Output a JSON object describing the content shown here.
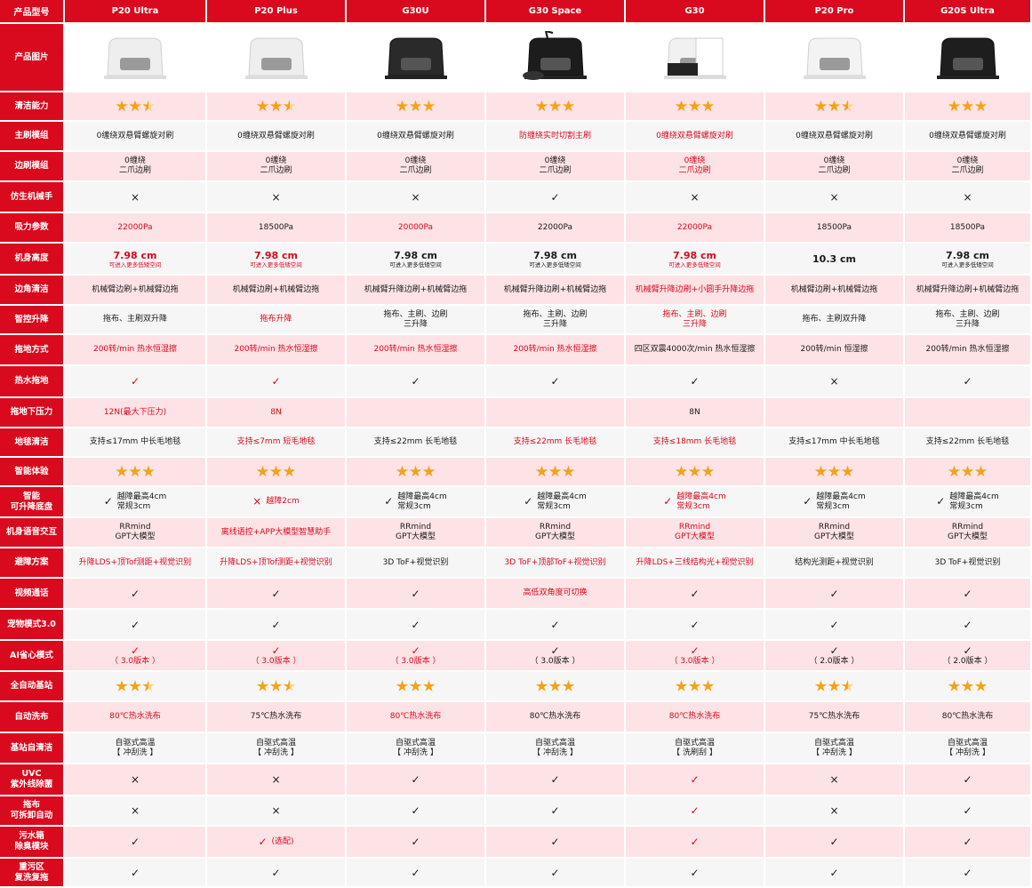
{
  "header_label": "产品型号",
  "models": [
    "P20 Ultra",
    "P20 Plus",
    "G30U",
    "G30 Space",
    "G30",
    "P20 Pro",
    "G20S Ultra"
  ],
  "image_row_label": "产品图片",
  "product_images": [
    {
      "icon": "robot-base-white-icon",
      "color": "#eeeeee"
    },
    {
      "icon": "robot-base-white-icon",
      "color": "#eeeeee"
    },
    {
      "icon": "robot-base-black-icon",
      "color": "#2a2a2a"
    },
    {
      "icon": "robot-base-black-arm-icon",
      "color": "#1c1c1c"
    },
    {
      "icon": "robot-base-white-black-icon",
      "color": "#f1f1f1"
    },
    {
      "icon": "robot-base-white-icon",
      "color": "#f3f3f3"
    },
    {
      "icon": "robot-base-black-icon",
      "color": "#1e1e1e"
    }
  ],
  "accent_color": "#d9091e",
  "star_color": "#f3a21a",
  "rows": [
    {
      "label": "清洁能力",
      "cells": [
        {
          "stars": 2.5
        },
        {
          "stars": 2.5
        },
        {
          "stars": 3
        },
        {
          "stars": 3
        },
        {
          "stars": 3
        },
        {
          "stars": 2.5
        },
        {
          "stars": 3
        }
      ]
    },
    {
      "label": "主刷模组",
      "cells": [
        {
          "text": "0缠绕双悬臂螺旋对刷"
        },
        {
          "text": "0缠绕双悬臂螺旋对刷"
        },
        {
          "text": "0缠绕双悬臂螺旋对刷"
        },
        {
          "text": "防缠绕实时切割主刷",
          "red": true
        },
        {
          "text": "0缠绕双悬臂螺旋对刷",
          "red": true
        },
        {
          "text": "0缠绕双悬臂螺旋对刷"
        },
        {
          "text": "0缠绕双悬臂螺旋对刷"
        }
      ]
    },
    {
      "label": "边刷模组",
      "cells": [
        {
          "text": "0缠绕\n二爪边刷"
        },
        {
          "text": "0缠绕\n二爪边刷"
        },
        {
          "text": "0缠绕\n二爪边刷"
        },
        {
          "text": "0缠绕\n二爪边刷"
        },
        {
          "text": "0缠绕\n二爪边刷",
          "red": true
        },
        {
          "text": "0缠绕\n二爪边刷"
        },
        {
          "text": "0缠绕\n二爪边刷"
        }
      ]
    },
    {
      "label": "仿生机械手",
      "cells": [
        {
          "mark": "×"
        },
        {
          "mark": "×"
        },
        {
          "mark": "×"
        },
        {
          "mark": "✓"
        },
        {
          "mark": "×"
        },
        {
          "mark": "×"
        },
        {
          "mark": "×"
        }
      ]
    },
    {
      "label": "吸力参数",
      "cells": [
        {
          "text": "22000Pa",
          "red": true
        },
        {
          "text": "18500Pa"
        },
        {
          "text": "20000Pa",
          "red": true
        },
        {
          "text": "22000Pa"
        },
        {
          "text": "22000Pa",
          "red": true
        },
        {
          "text": "18500Pa"
        },
        {
          "text": "18500Pa"
        }
      ]
    },
    {
      "label": "机身高度",
      "cells": [
        {
          "big": "7.98 cm",
          "small": "可进入更多低矮空间",
          "red": true
        },
        {
          "big": "7.98 cm",
          "small": "可进入更多低矮空间",
          "red": true
        },
        {
          "big": "7.98 cm",
          "small": "可进入更多低矮空间"
        },
        {
          "big": "7.98 cm",
          "small": "可进入更多低矮空间"
        },
        {
          "big": "7.98 cm",
          "small": "可进入更多低矮空间",
          "red": true
        },
        {
          "big": "10.3 cm"
        },
        {
          "big": "7.98 cm",
          "small": "可进入更多低矮空间"
        }
      ]
    },
    {
      "label": "边角清洁",
      "cells": [
        {
          "text": "机械臂边刷+机械臂边拖"
        },
        {
          "text": "机械臂边刷+机械臂边拖"
        },
        {
          "text": "机械臂升降边刷+机械臂边拖"
        },
        {
          "text": "机械臂升降边刷+机械臂边拖"
        },
        {
          "text": "机械臂升降边刷+小圆手升降边拖",
          "red": true
        },
        {
          "text": "机械臂边刷+机械臂边拖"
        },
        {
          "text": "机械臂升降边刷+机械臂边拖"
        }
      ]
    },
    {
      "label": "智控升降",
      "cells": [
        {
          "text": "拖布、主刷双升降"
        },
        {
          "text": "拖布升降",
          "red": true
        },
        {
          "text": "拖布、主刷、边刷\n三升降"
        },
        {
          "text": "拖布、主刷、边刷\n三升降"
        },
        {
          "text": "拖布、主刷、边刷\n三升降",
          "red": true
        },
        {
          "text": "拖布、主刷双升降"
        },
        {
          "text": "拖布、主刷、边刷\n三升降"
        }
      ]
    },
    {
      "label": "拖地方式",
      "cells": [
        {
          "text": "200转/min 热水恒湿擦",
          "red": true
        },
        {
          "text": "200转/min 热水恒湿擦",
          "red": true
        },
        {
          "text": "200转/min 热水恒湿擦",
          "red": true
        },
        {
          "text": "200转/min 热水恒湿擦",
          "red": true
        },
        {
          "text": "四区双震4000次/min 热水恒湿擦"
        },
        {
          "text": "200转/min 恒湿擦"
        },
        {
          "text": "200转/min 热水恒湿擦"
        }
      ]
    },
    {
      "label": "热水拖地",
      "cells": [
        {
          "mark": "✓",
          "red": true
        },
        {
          "mark": "✓",
          "red": true
        },
        {
          "mark": "✓"
        },
        {
          "mark": "✓"
        },
        {
          "mark": "✓"
        },
        {
          "mark": "×"
        },
        {
          "mark": "✓"
        }
      ]
    },
    {
      "label": "拖地下压力",
      "cells": [
        {
          "text": "12N(最大下压力)",
          "red": true
        },
        {
          "text": "8N",
          "red": true
        },
        {
          "text": ""
        },
        {
          "text": ""
        },
        {
          "text": "8N"
        },
        {
          "text": ""
        },
        {
          "text": ""
        }
      ]
    },
    {
      "label": "地毯清洁",
      "cells": [
        {
          "text": "支持≤17mm 中长毛地毯"
        },
        {
          "text": "支持≤7mm 短毛地毯",
          "red": true
        },
        {
          "text": "支持≤22mm 长毛地毯"
        },
        {
          "text": "支持≤22mm 长毛地毯",
          "red": true
        },
        {
          "text": "支持≤18mm 长毛地毯",
          "red": true
        },
        {
          "text": "支持≤17mm 中长毛地毯"
        },
        {
          "text": "支持≤22mm 长毛地毯"
        }
      ]
    },
    {
      "label": "智能体验",
      "cells": [
        {
          "stars": 3
        },
        {
          "stars": 3
        },
        {
          "stars": 3
        },
        {
          "stars": 3
        },
        {
          "stars": 3
        },
        {
          "stars": 3
        },
        {
          "stars": 3
        }
      ]
    },
    {
      "label": "智能\n可升降底盘",
      "cells": [
        {
          "prefix": "✓",
          "text": "越障最高4cm\n常规3cm"
        },
        {
          "prefix": "×",
          "text": "越障2cm",
          "red": true
        },
        {
          "prefix": "✓",
          "text": "越障最高4cm\n常规3cm"
        },
        {
          "prefix": "✓",
          "text": "越障最高4cm\n常规3cm"
        },
        {
          "prefix": "✓",
          "text": "越障最高4cm\n常规3cm",
          "red": true
        },
        {
          "prefix": "✓",
          "text": "越障最高4cm\n常规3cm"
        },
        {
          "prefix": "✓",
          "text": "越障最高4cm\n常规3cm"
        }
      ]
    },
    {
      "label": "机身语音交互",
      "cells": [
        {
          "text": "RRmind\nGPT大模型"
        },
        {
          "text": "离线语控+APP大模型智慧助手",
          "red": true
        },
        {
          "text": "RRmind\nGPT大模型"
        },
        {
          "text": "RRmind\nGPT大模型"
        },
        {
          "text": "RRmind\nGPT大模型",
          "red": true
        },
        {
          "text": "RRmind\nGPT大模型"
        },
        {
          "text": "RRmind\nGPT大模型"
        }
      ]
    },
    {
      "label": "避障方案",
      "cells": [
        {
          "text": "升降LDS+顶Tof测距+视觉识别",
          "red": true
        },
        {
          "text": "升降LDS+顶Tof测距+视觉识别",
          "red": true
        },
        {
          "text": "3D ToF+视觉识别"
        },
        {
          "text": "3D ToF+顶部ToF+视觉识别",
          "red": true
        },
        {
          "text": "升降LDS+三线结构光+视觉识别",
          "red": true
        },
        {
          "text": "结构光测距+视觉识别"
        },
        {
          "text": "3D ToF+视觉识别"
        }
      ]
    },
    {
      "label": "视频通话",
      "cells": [
        {
          "mark": "✓"
        },
        {
          "mark": "✓"
        },
        {
          "mark": "✓"
        },
        {
          "text": "高低双角度可切换",
          "red": true
        },
        {
          "mark": "✓"
        },
        {
          "mark": "✓"
        },
        {
          "mark": "✓"
        }
      ]
    },
    {
      "label": "宠物模式3.0",
      "cells": [
        {
          "mark": "✓"
        },
        {
          "mark": "✓"
        },
        {
          "mark": "✓"
        },
        {
          "mark": "✓"
        },
        {
          "mark": "✓"
        },
        {
          "mark": "✓"
        },
        {
          "mark": "✓"
        }
      ]
    },
    {
      "label": "AI省心模式",
      "cells": [
        {
          "mark": "✓",
          "text": "（ 3.0版本 ）",
          "red": true
        },
        {
          "mark": "✓",
          "text": "（ 3.0版本 ）",
          "red": true
        },
        {
          "mark": "✓",
          "text": "（ 3.0版本 ）",
          "red": true
        },
        {
          "mark": "✓",
          "text": "（ 3.0版本 ）"
        },
        {
          "mark": "✓",
          "text": "（ 3.0版本 ）",
          "red": true
        },
        {
          "mark": "✓",
          "text": "（ 2.0版本 ）"
        },
        {
          "mark": "✓",
          "text": "（ 2.0版本 ）"
        }
      ]
    },
    {
      "label": "全自动基站",
      "cells": [
        {
          "stars": 2.5
        },
        {
          "stars": 2.5
        },
        {
          "stars": 3
        },
        {
          "stars": 3
        },
        {
          "stars": 3
        },
        {
          "stars": 2.5
        },
        {
          "stars": 3
        }
      ]
    },
    {
      "label": "自动洗布",
      "cells": [
        {
          "text": "80℃热水洗布",
          "red": true
        },
        {
          "text": "75℃热水洗布"
        },
        {
          "text": "80℃热水洗布",
          "red": true
        },
        {
          "text": "80℃热水洗布"
        },
        {
          "text": "80℃热水洗布",
          "red": true
        },
        {
          "text": "75℃热水洗布"
        },
        {
          "text": "80℃热水洗布"
        }
      ]
    },
    {
      "label": "基站自清洁",
      "cells": [
        {
          "text": "自驱式高温\n【 冲刮洗 】"
        },
        {
          "text": "自驱式高温\n【 冲刮洗 】"
        },
        {
          "text": "自驱式高温\n【 冲刮洗 】"
        },
        {
          "text": "自驱式高温\n【 冲刮洗 】"
        },
        {
          "text": "自驱式高温\n【 洗刷刮 】"
        },
        {
          "text": "自驱式高温\n【 冲刮洗 】"
        },
        {
          "text": "自驱式高温\n【 冲刮洗 】"
        }
      ]
    },
    {
      "label": "UVC\n紫外线除菌",
      "cells": [
        {
          "mark": "×"
        },
        {
          "mark": "×"
        },
        {
          "mark": "✓"
        },
        {
          "mark": "✓"
        },
        {
          "mark": "✓",
          "red": true
        },
        {
          "mark": "×"
        },
        {
          "mark": "✓"
        }
      ]
    },
    {
      "label": "拖布\n可拆卸自动",
      "cells": [
        {
          "mark": "×"
        },
        {
          "mark": "×"
        },
        {
          "mark": "✓"
        },
        {
          "mark": "✓"
        },
        {
          "mark": "✓",
          "red": true
        },
        {
          "mark": "×"
        },
        {
          "mark": "✓"
        }
      ]
    },
    {
      "label": "污水箱\n除臭模块",
      "cells": [
        {
          "mark": "✓"
        },
        {
          "mark": "✓",
          "text": "(选配)",
          "red": true,
          "inline": true
        },
        {
          "mark": "✓"
        },
        {
          "mark": "✓"
        },
        {
          "mark": "✓",
          "red": true
        },
        {
          "mark": "✓"
        },
        {
          "mark": "✓"
        }
      ]
    },
    {
      "label": "重污区\n复洗复拖",
      "cells": [
        {
          "mark": "✓"
        },
        {
          "mark": "✓"
        },
        {
          "mark": "✓"
        },
        {
          "mark": "✓"
        },
        {
          "mark": "✓"
        },
        {
          "mark": "✓"
        },
        {
          "mark": "✓"
        }
      ]
    }
  ]
}
